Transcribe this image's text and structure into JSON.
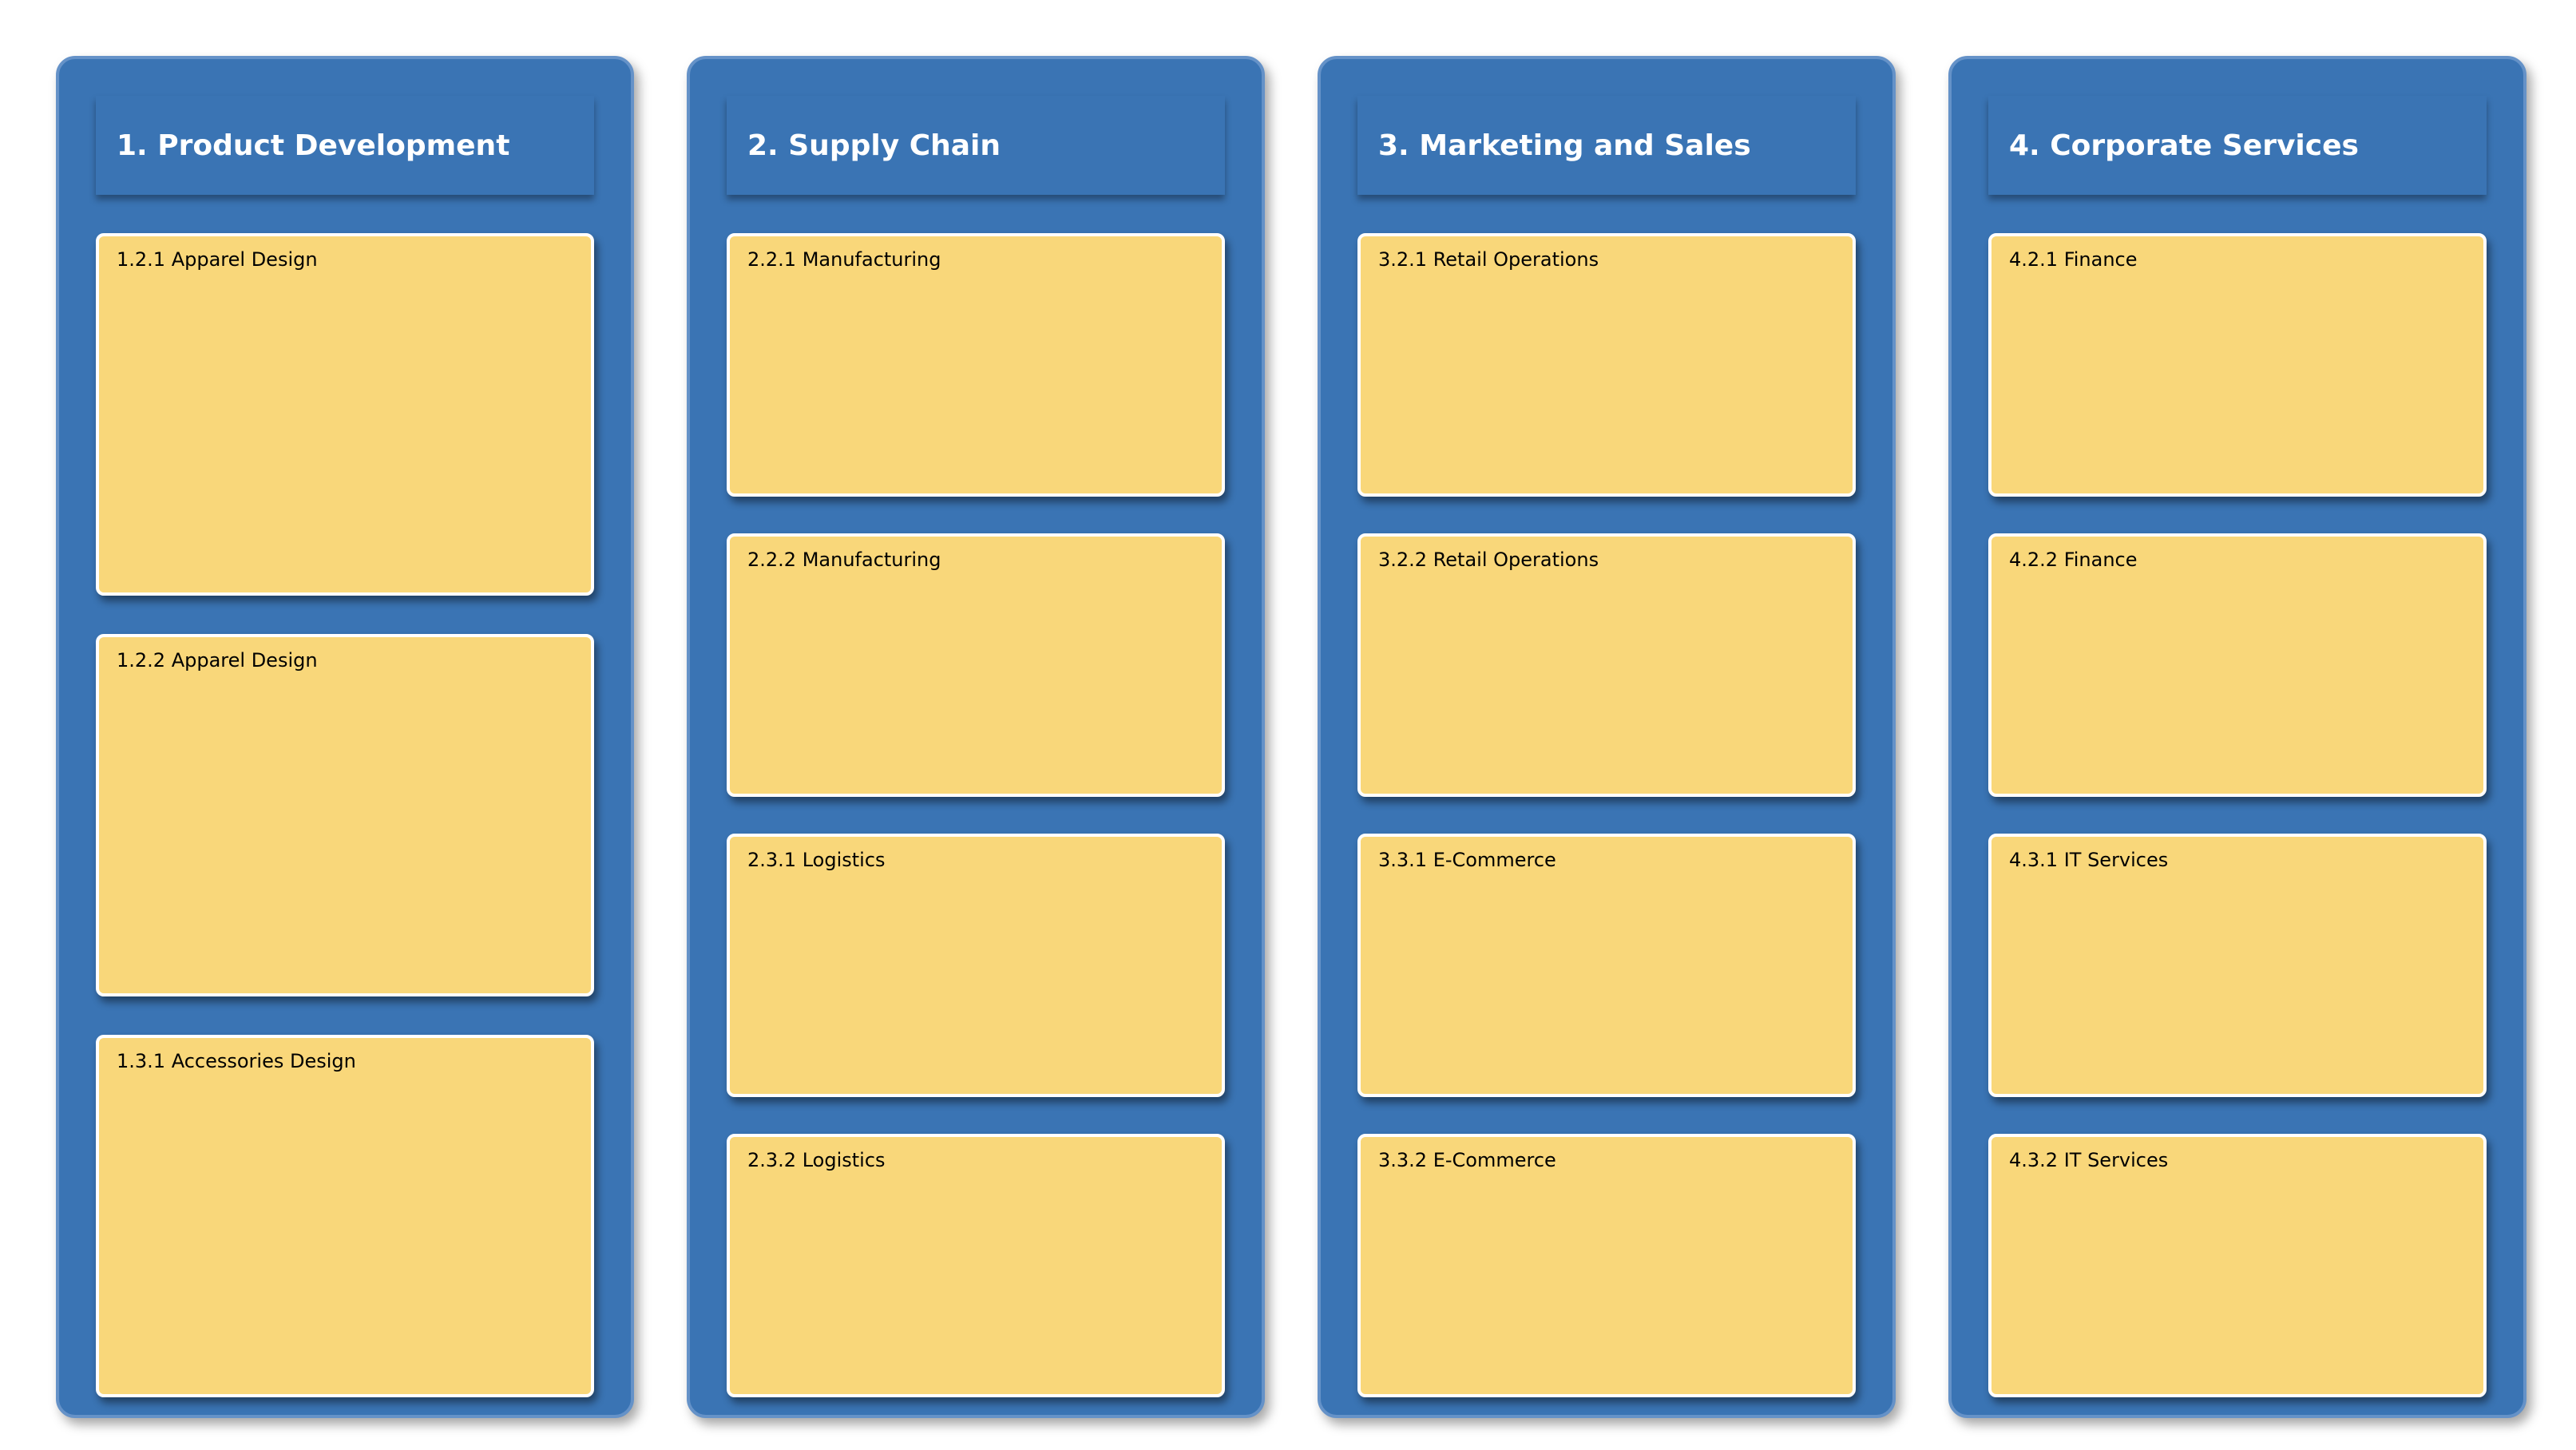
{
  "colors": {
    "column_fill": "#3a74b4",
    "column_border": "#6592c8",
    "card_fill": "#f9d77a",
    "card_border": "#ffffff",
    "title_text": "#ffffff",
    "card_text": "#000000"
  },
  "columns": [
    {
      "title": "1. Product Development",
      "cards": [
        {
          "label": "1.2.1 Apparel Design"
        },
        {
          "label": "1.2.2 Apparel Design"
        },
        {
          "label": "1.3.1 Accessories Design"
        }
      ]
    },
    {
      "title": "2. Supply Chain",
      "cards": [
        {
          "label": "2.2.1 Manufacturing"
        },
        {
          "label": "2.2.2 Manufacturing"
        },
        {
          "label": "2.3.1 Logistics"
        },
        {
          "label": "2.3.2 Logistics"
        }
      ]
    },
    {
      "title": "3. Marketing and Sales",
      "cards": [
        {
          "label": "3.2.1 Retail Operations"
        },
        {
          "label": "3.2.2 Retail Operations"
        },
        {
          "label": "3.3.1 E-Commerce"
        },
        {
          "label": "3.3.2 E-Commerce"
        }
      ]
    },
    {
      "title": "4. Corporate Services",
      "cards": [
        {
          "label": "4.2.1 Finance"
        },
        {
          "label": "4.2.2 Finance"
        },
        {
          "label": "4.3.1 IT Services"
        },
        {
          "label": "4.3.2 IT Services"
        }
      ]
    }
  ]
}
